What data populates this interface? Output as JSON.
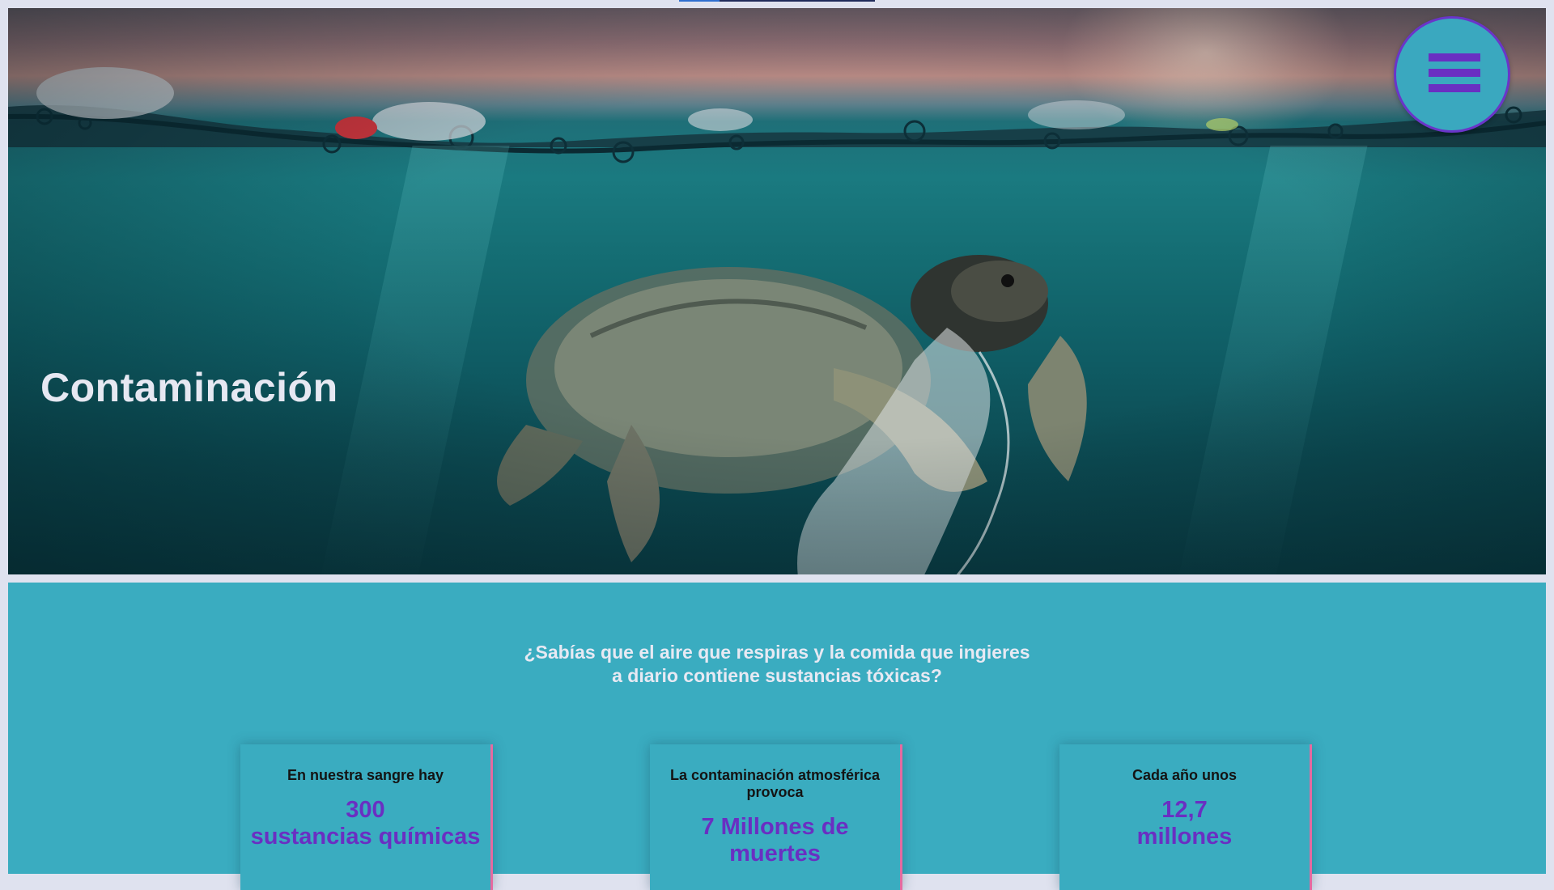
{
  "hero": {
    "title": "Contaminación",
    "image_description_icon": "turtle-with-plastic-bag-icon"
  },
  "menu": {
    "icon": "hamburger-menu-icon"
  },
  "info": {
    "question_line1": "¿Sabías que el aire que respiras y la comida que ingieres",
    "question_line2": "a diario contiene sustancias tóxicas?",
    "cards": [
      {
        "lead": "En nuestra sangre hay",
        "value_line1": "300",
        "value_line2": "sustancias químicas"
      },
      {
        "lead": "La contaminación atmosférica provoca",
        "value_line1": "7 Millones de",
        "value_line2": "muertes"
      },
      {
        "lead": "Cada año unos",
        "value_line1": "12,7",
        "value_line2": "millones"
      }
    ]
  },
  "colors": {
    "background": "#dfe2ef",
    "section_teal": "#3aacc0",
    "accent_purple": "#6a2fc2",
    "card_border_pink": "#e56aa0",
    "hero_title": "#e6e8f2"
  }
}
